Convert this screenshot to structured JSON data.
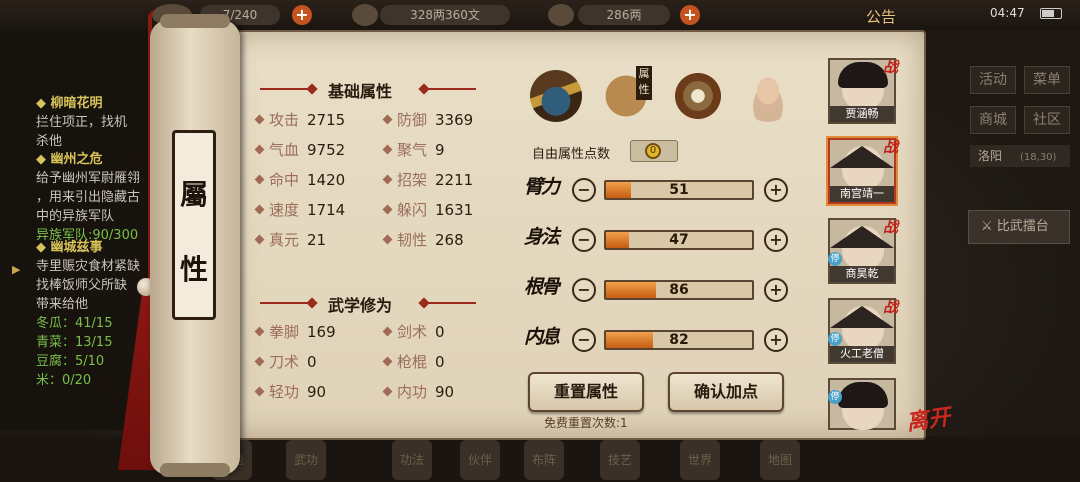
{
  "topbar": {
    "stamina": "7/240",
    "money": "328两360文",
    "gold": "286两",
    "announcement": "公告",
    "time": "04:47"
  },
  "quests": [
    {
      "title": "柳暗花明",
      "desc": [
        "拦住项正，找机",
        "杀他"
      ]
    },
    {
      "title": "幽州之危",
      "desc": [
        "给予幽州军尉雁翎",
        "，用来引出隐藏古",
        "中的异族军队"
      ],
      "progress": "异族军队:90/300"
    },
    {
      "title": "幽城兹事",
      "desc": [
        "寺里赈灾食材紧缺",
        "找棒饭师父所缺",
        "带来给他"
      ],
      "items": [
        "冬瓜：41/15",
        "青菜：13/15",
        "豆腐：5/10",
        "米：0/20"
      ]
    }
  ],
  "right_menu": {
    "buttons": [
      "活动",
      "菜单",
      "商城",
      "社区"
    ],
    "location": "洛阳",
    "coords": "(18,30)",
    "arena": "比武擂台"
  },
  "bottom_menu": [
    "背包",
    "武功",
    "功法",
    "伙伴",
    "布阵",
    "技艺",
    "世界",
    "地图"
  ],
  "scroll": {
    "title_top": "屬",
    "title_bottom": "性"
  },
  "basic": {
    "title": "基础属性",
    "stats": [
      {
        "label": "攻击",
        "value": "2715"
      },
      {
        "label": "防御",
        "value": "3369"
      },
      {
        "label": "气血",
        "value": "9752"
      },
      {
        "label": "聚气",
        "value": "9"
      },
      {
        "label": "命中",
        "value": "1420"
      },
      {
        "label": "招架",
        "value": "2211"
      },
      {
        "label": "速度",
        "value": "1714"
      },
      {
        "label": "躲闪",
        "value": "1631"
      },
      {
        "label": "真元",
        "value": "21"
      },
      {
        "label": "韧性",
        "value": "268"
      }
    ]
  },
  "martial": {
    "title": "武学修为",
    "stats": [
      {
        "label": "拳脚",
        "value": "169"
      },
      {
        "label": "剑术",
        "value": "0"
      },
      {
        "label": "刀术",
        "value": "0"
      },
      {
        "label": "枪棍",
        "value": "0"
      },
      {
        "label": "轻功",
        "value": "90"
      },
      {
        "label": "内功",
        "value": "90"
      }
    ]
  },
  "tabs": [
    {
      "icon": "hat-character-icon"
    },
    {
      "icon": "attribute-book-icon",
      "label": "属性"
    },
    {
      "icon": "bagua-icon"
    },
    {
      "icon": "body-meridian-icon"
    }
  ],
  "allocation": {
    "free_label": "自由属性点数",
    "free_points": "0",
    "bars": [
      {
        "label": "臂力",
        "value": "51",
        "fraction": 0.17
      },
      {
        "label": "身法",
        "value": "47",
        "fraction": 0.16
      },
      {
        "label": "根骨",
        "value": "86",
        "fraction": 0.34
      },
      {
        "label": "内息",
        "value": "82",
        "fraction": 0.32
      }
    ],
    "reset_button": "重置属性",
    "confirm_button": "确认加点",
    "reset_note": "免费重置次数:1"
  },
  "characters": [
    {
      "name": "贾涵畅",
      "battle": "战"
    },
    {
      "name": "南宫靖一",
      "battle": "战"
    },
    {
      "name": "商昊乾",
      "battle": "战",
      "badge": "停"
    },
    {
      "name": "火工老僧",
      "battle": "战",
      "badge": "停"
    },
    {
      "name": "",
      "badge": "停"
    }
  ],
  "leave": "离开",
  "colors": {
    "accent": "#c55d12",
    "paper": "#e9dec7",
    "battle_red": "#c0201a"
  }
}
